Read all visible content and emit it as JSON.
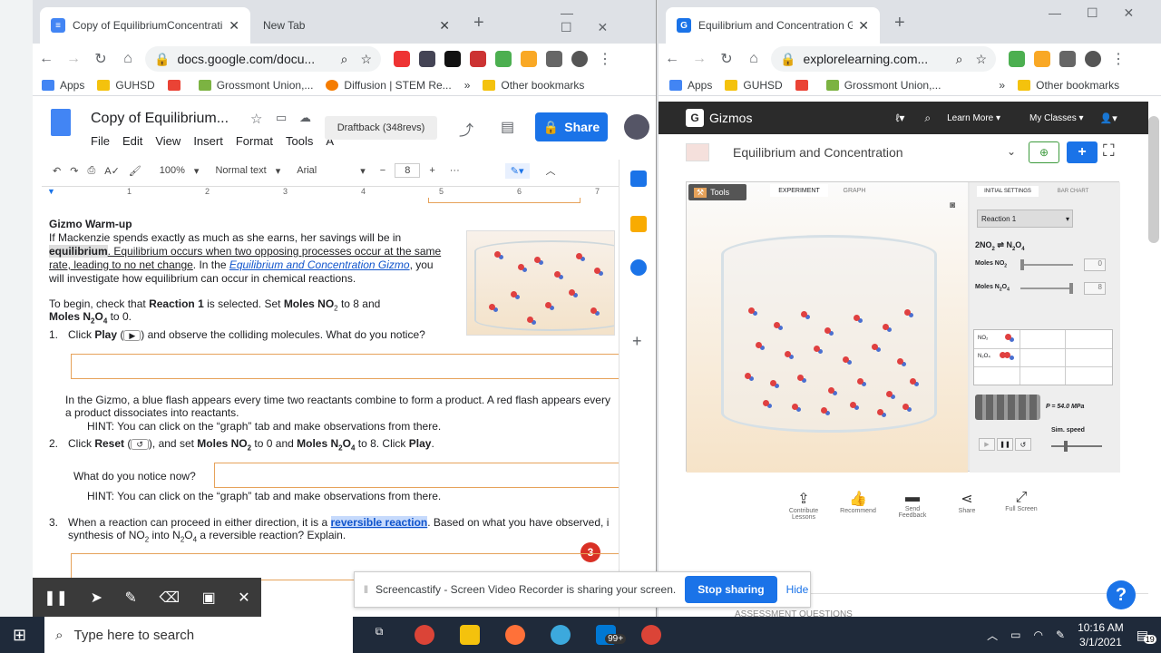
{
  "left_tabs": [
    {
      "title": "Copy of EquilibriumConcentrati",
      "active": true
    },
    {
      "title": "New Tab",
      "active": false
    }
  ],
  "left_url": "docs.google.com/docu...",
  "right_tabs": [
    {
      "title": "Equilibrium and Concentration G",
      "active": true
    }
  ],
  "right_url": "explorelearning.com...",
  "bookmarks": {
    "apps": "Apps",
    "guhsd": "GUHSD",
    "grossmont": "Grossmont Union,...",
    "diffusion": "Diffusion | STEM Re...",
    "other": "Other bookmarks",
    "more": "»"
  },
  "docs": {
    "title": "Copy of Equilibrium...",
    "menu": [
      "File",
      "Edit",
      "View",
      "Insert",
      "Format",
      "Tools",
      "A"
    ],
    "draftback": "Draftback (348revs)",
    "share": "Share",
    "toolbar": {
      "zoom": "100%",
      "style": "Normal text",
      "font": "Arial",
      "size": "8",
      "minus": "−",
      "plus": "+",
      "more": "···"
    },
    "ruler": [
      "1",
      "2",
      "3",
      "4",
      "5",
      "6",
      "7"
    ],
    "heading": "Gizmo Warm-up",
    "p1a": "If Mackenzie spends exactly as much as she earns, her savings will be in",
    "p1b": "equilibrium",
    "p1c": ". Equilibrium occurs when two opposing processes occur at the same",
    "p1d": "rate, leading to no net change",
    "p1e": ". In the ",
    "p1link": "Equilibrium and Concentration Gizmo",
    "p1f": ", you",
    "p1g": "will investigate how equilibrium can occur in chemical reactions.",
    "p2a": "To begin, check that ",
    "p2b": "Reaction 1",
    "p2c": " is selected. Set ",
    "p2d": "Moles NO",
    "p2sub": "2",
    "p2e": " to 8 and",
    "p3a": "Moles N",
    "p3sub1": "2",
    "p3b": "O",
    "p3sub2": "4",
    "p3c": " to 0.",
    "q1num": "1.",
    "q1a": "Click ",
    "q1b": "Play",
    "q1c": " (",
    "q1d": ") and observe the colliding molecules. What do you notice?",
    "a1a": "In the Gizmo, a blue flash appears every time two reactants combine to form a product. A red flash appears every",
    "a1b": "a product dissociates into reactants.",
    "hint1": "HINT: You can click on the “graph” tab and make observations from there.",
    "q2num": "2.",
    "q2a": "Click ",
    "q2b": "Reset",
    "q2c": " (",
    "q2d": "), and set ",
    "q2e": "Moles NO",
    "q2sub": "2",
    "q2f": " to 0 and ",
    "q2g": "Moles N",
    "q2sub2": "2",
    "q2h": "O",
    "q2sub3": "4",
    "q2i": " to 8. Click ",
    "q2j": "Play",
    "q2k": ".",
    "notice": "What do you notice now?",
    "hint2": "HINT: You can click on the “graph” tab and make observations from there.",
    "q3num": "3.",
    "q3a": "When a reaction can proceed in either direction, it is a ",
    "q3b": "reversible reaction",
    "q3c": ". Based on what you have observed, i",
    "q3d": "synthesis of NO",
    "q3sub": "2",
    "q3e": " into N",
    "q3sub2": "2",
    "q3f": "O",
    "q3sub3": "4",
    "q3g": " a reversible reaction? Explain.",
    "badge": "3"
  },
  "gizmo": {
    "brand": "Gizmos",
    "learn": "Learn More",
    "classes": "My Classes",
    "title": "Equilibrium and Concentration",
    "tools": "Tools",
    "tab_exp": "EXPERIMENT",
    "tab_graph": "GRAPH",
    "tab_init": "INITIAL SETTINGS",
    "tab_bar": "BAR CHART",
    "reaction": "Reaction 1",
    "eq_left": "2NO",
    "eq_left_sub": "2",
    "eq_right": "N",
    "eq_r_sub1": "2",
    "eq_r_o": "O",
    "eq_r_sub2": "4",
    "moles_no2": "Moles NO",
    "no2_sub": "2",
    "no2_val": "0",
    "moles_n2o4": "Moles N",
    "n2o4_sub": "2",
    "n2o4_o": "O",
    "n2o4_sub2": "4",
    "n2o4_val": "8",
    "row1": "NO₂",
    "row2": "N₂O₄",
    "pressure": "P = 54.0 MPa",
    "sim": "Sim. speed",
    "actions": [
      {
        "icon": "contribute",
        "label": "Contribute Lessons"
      },
      {
        "icon": "recommend",
        "label": "Recommend"
      },
      {
        "icon": "feedback",
        "label": "Send Feedback"
      },
      {
        "icon": "share",
        "label": "Share"
      },
      {
        "icon": "fullscreen",
        "label": "Full Screen"
      }
    ],
    "assessment": "ASSESSMENT QUESTIONS"
  },
  "screencastify": {
    "msg": "Screencastify - Screen Video Recorder is sharing your screen.",
    "stop": "Stop sharing",
    "hide": "Hide"
  },
  "taskbar": {
    "search": "Type here to search",
    "time": "10:16 AM",
    "date": "3/1/2021",
    "badge": "99+",
    "notif": "19"
  },
  "colors": {
    "accent": "#1a73e8",
    "gizmo_dark": "#2b2b2b",
    "orange": "#e6a25a"
  }
}
